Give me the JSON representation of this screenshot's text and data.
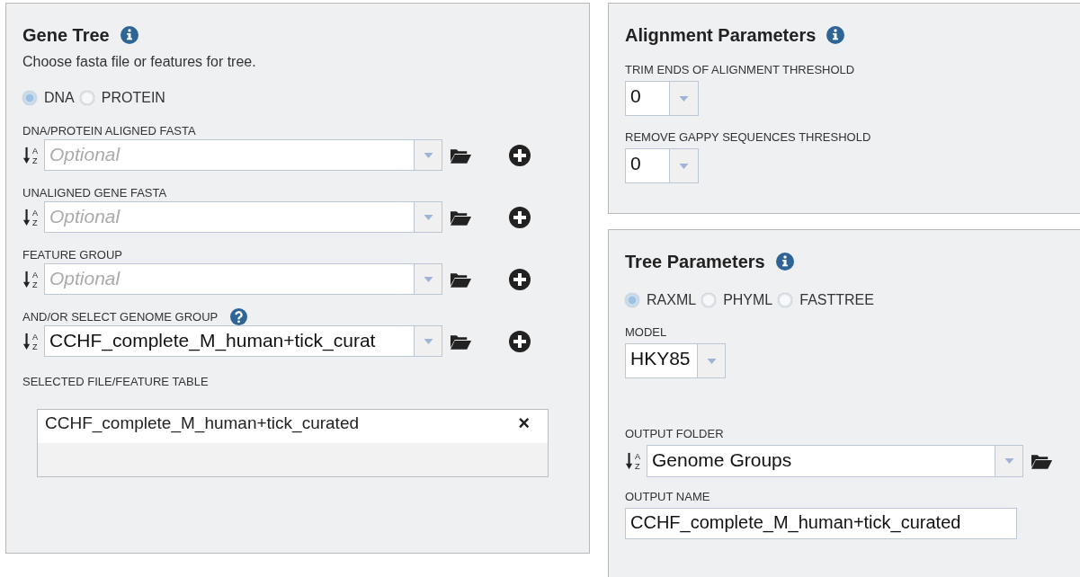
{
  "gene_tree": {
    "title": "Gene Tree",
    "description": "Choose fasta file or features for tree.",
    "sequence_types": [
      {
        "label": "DNA",
        "selected": true
      },
      {
        "label": "PROTEIN",
        "selected": false
      }
    ],
    "fields": [
      {
        "label": "DNA/PROTEIN ALIGNED FASTA",
        "help": false,
        "placeholder": "Optional",
        "sort": {
          "top": "A",
          "bottom": "Z"
        }
      },
      {
        "label": "UNALIGNED GENE FASTA",
        "help": false,
        "placeholder": "Optional",
        "sort": {
          "top": "A",
          "bottom": "Z"
        }
      },
      {
        "label": "FEATURE GROUP",
        "help": false,
        "placeholder": "Optional",
        "sort": {
          "top": "A",
          "bottom": "Z"
        }
      },
      {
        "label": "AND/OR SELECT GENOME GROUP",
        "help": true,
        "value": "CCHF_complete_M_human+tick_curat",
        "sort": {
          "top": "A",
          "bottom": "Z"
        }
      }
    ],
    "selected_table": {
      "label": "SELECTED FILE/FEATURE TABLE",
      "rows": [
        {
          "name": "CCHF_complete_M_human+tick_curated",
          "remove": "×"
        }
      ]
    }
  },
  "alignment_parameters": {
    "title": "Alignment Parameters",
    "fields": [
      {
        "label": "TRIM ENDS OF ALIGNMENT THRESHOLD",
        "value": "0"
      },
      {
        "label": "REMOVE GAPPY SEQUENCES THRESHOLD",
        "value": "0"
      }
    ]
  },
  "tree_parameters": {
    "title": "Tree Parameters",
    "programs": [
      {
        "label": "RAXML",
        "selected": true
      },
      {
        "label": "PHYML",
        "selected": false
      },
      {
        "label": "FASTTREE",
        "selected": false
      }
    ],
    "model": {
      "label": "MODEL",
      "value": "HKY85"
    },
    "output_folder": {
      "label": "OUTPUT FOLDER",
      "value": "Genome Groups",
      "sort": {
        "top": "A",
        "bottom": "Z"
      }
    },
    "output_name": {
      "label": "OUTPUT NAME",
      "value": "CCHF_complete_M_human+tick_curated"
    }
  }
}
